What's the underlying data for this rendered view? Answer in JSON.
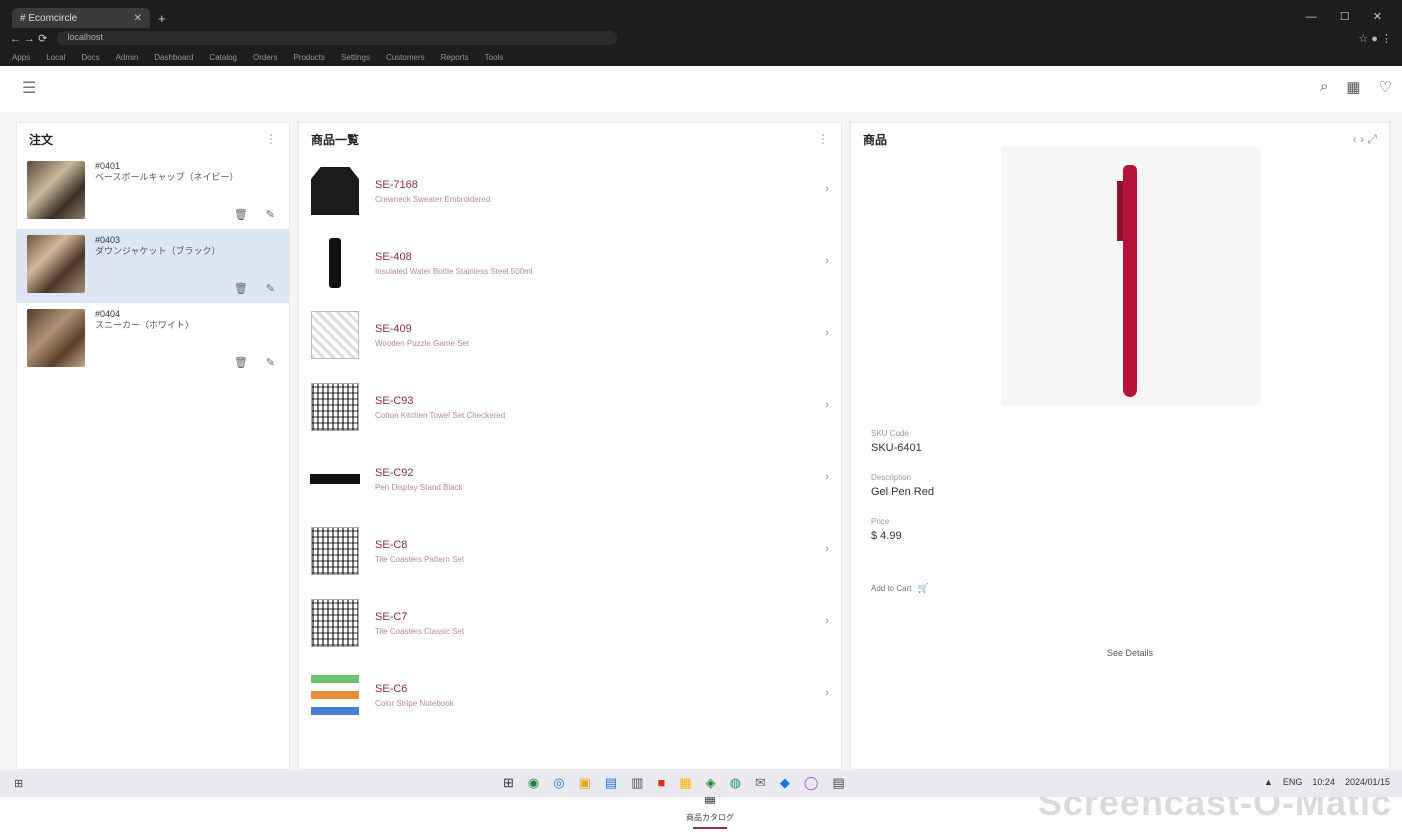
{
  "browser": {
    "tab_title": "# Ecomcircle",
    "new_tab": "+",
    "window_controls": "— ☐ ✕",
    "nav_icons": "← → ⟳",
    "address": "localhost",
    "toolbar_icons": "☆ ● ⋮",
    "bookmarks": [
      "Apps",
      "Local",
      "Docs",
      "Admin",
      "Dashboard",
      "Catalog",
      "Orders",
      "Products",
      "Settings",
      "Customers",
      "Reports",
      "Tools"
    ]
  },
  "appbar": {
    "menu_icon": "☰",
    "search_icon": "⌕",
    "grid_icon": "▦",
    "cart_icon": "♡"
  },
  "orders_pane": {
    "title": "注文",
    "more": "⋮",
    "items": [
      {
        "id": "#0401",
        "desc": "ベースボールキャップ（ネイビー）",
        "icon_a": "🗑",
        "icon_b": "✎"
      },
      {
        "id": "#0403",
        "desc": "ダウンジャケット（ブラック）",
        "icon_a": "🗑",
        "icon_b": "✎"
      },
      {
        "id": "#0404",
        "desc": "スニーカー（ホワイト）",
        "icon_a": "🗑",
        "icon_b": "✎"
      }
    ]
  },
  "products_pane": {
    "title": "商品一覧",
    "more": "⋮",
    "arrow": "›",
    "items": [
      {
        "code": "SE-7168",
        "desc": "Crewneck Sweater Embroidered"
      },
      {
        "code": "SE-408",
        "desc": "Insulated Water Bottle Stainless Steel 500ml"
      },
      {
        "code": "SE-409",
        "desc": "Wooden Puzzle Game Set"
      },
      {
        "code": "SE-C93",
        "desc": "Cotton Kitchen Towel Set Checkered"
      },
      {
        "code": "SE-C92",
        "desc": "Pen Display Stand Black"
      },
      {
        "code": "SE-C8",
        "desc": "Tile Coasters Pattern Set"
      },
      {
        "code": "SE-C7",
        "desc": "Tile Coasters Classic Set"
      },
      {
        "code": "SE-C6",
        "desc": "Color Stripe Notebook"
      }
    ]
  },
  "detail_pane": {
    "title": "商品",
    "controls": "‹ › ⤢",
    "fields": [
      {
        "label": "SKU Code",
        "value": "SKU-6401"
      },
      {
        "label": "Description",
        "value": "Gel Pen Red"
      },
      {
        "label": "Price",
        "value": "$ 4.99"
      }
    ],
    "chip_label": "Add to Cart",
    "chip_icon": "🛒",
    "center_link": "See Details"
  },
  "bottom_nav": {
    "icon": "▦",
    "label": "商品カタログ"
  },
  "watermark": "Screencast-O-Matic",
  "taskbar": {
    "start": "⊞",
    "apps": [
      "⊞",
      "◉",
      "◎",
      "▣",
      "▤",
      "▥",
      "■",
      "▦",
      "◈",
      "◍",
      "✉",
      "◆",
      "◯",
      "▤"
    ],
    "tray": [
      "▲",
      "ENG",
      "10:24",
      "2024/01/15"
    ]
  },
  "colors": {
    "accent": "#8a2e43",
    "selection": "#dde6f2",
    "pen": "#b5123a"
  }
}
